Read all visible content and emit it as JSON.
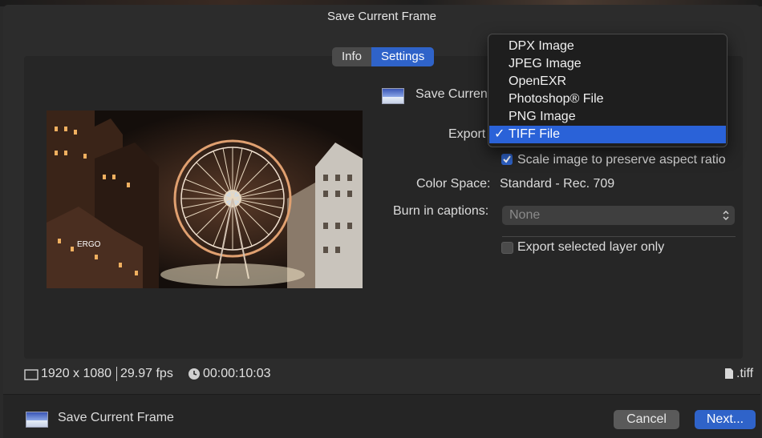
{
  "window": {
    "title": "Save Current Frame"
  },
  "tabs": [
    {
      "label": "Info",
      "active": false
    },
    {
      "label": "Settings",
      "active": true
    }
  ],
  "settings": {
    "save_label_partial": "Save Curren",
    "export_label": "Export",
    "scale_checkbox": {
      "label": "Scale image to preserve aspect ratio",
      "checked": true
    },
    "color_space_label": "Color Space:",
    "color_space_value": "Standard - Rec. 709",
    "burn_in_label": "Burn in captions:",
    "burn_in_value": "None",
    "export_layer_checkbox": {
      "label": "Export selected layer only",
      "checked": false
    }
  },
  "export_menu": {
    "options": [
      "DPX Image",
      "JPEG Image",
      "OpenEXR",
      "Photoshop® File",
      "PNG Image",
      "TIFF File"
    ],
    "selected": "TIFF File",
    "check_glyph": "✓"
  },
  "footer_info": {
    "resolution": "1920 x 1080",
    "fps": "29.97 fps",
    "timecode": "00:00:10:03",
    "file_ext": ".tiff"
  },
  "bottom": {
    "title": "Save Current Frame",
    "cancel": "Cancel",
    "next": "Next..."
  },
  "colors": {
    "accent": "#2f63c9",
    "menu_highlight": "#2a62d8",
    "background": "#2c2c2c"
  },
  "icons": [
    "display-icon",
    "clock-icon",
    "document-icon",
    "share-thumbnail-icon",
    "checkmark-icon",
    "stepper-chevrons-icon"
  ]
}
